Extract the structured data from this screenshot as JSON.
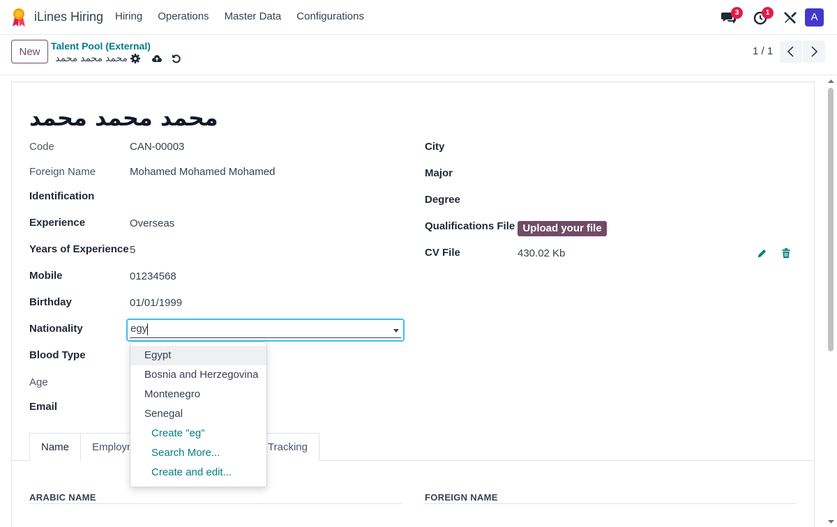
{
  "navbar": {
    "app_name": "iLines Hiring",
    "menu": [
      "Hiring",
      "Operations",
      "Master Data",
      "Configurations"
    ],
    "messages_badge": "3",
    "activities_badge": "1",
    "avatar_letter": "A"
  },
  "control": {
    "new_label": "New",
    "breadcrumb_parent": "Talent Pool (External)",
    "breadcrumb_current": "محمد محمد محمد",
    "pager": "1 / 1"
  },
  "record": {
    "title": "محمد محمد محمد",
    "left_fields": [
      {
        "label": "Code",
        "value": "CAN-00003",
        "bold": false
      },
      {
        "label": "Foreign Name",
        "value": "Mohamed Mohamed Mohamed",
        "bold": false
      },
      {
        "label": "Identification",
        "value": "",
        "bold": true
      },
      {
        "label": "Experience",
        "value": "Overseas",
        "bold": true
      },
      {
        "label": "Years of Experience",
        "value": "5",
        "bold": true
      },
      {
        "label": "Mobile",
        "value": "01234568",
        "bold": true
      },
      {
        "label": "Birthday",
        "value": "01/01/1999",
        "bold": true
      },
      {
        "label": "Nationality",
        "value": "",
        "bold": true
      },
      {
        "label": "Blood Type",
        "value": "",
        "bold": true
      },
      {
        "label": "Age",
        "value": "",
        "bold": false
      },
      {
        "label": "Email",
        "value": "",
        "bold": true
      }
    ],
    "right_fields": [
      {
        "label": "City",
        "value": ""
      },
      {
        "label": "Major",
        "value": ""
      },
      {
        "label": "Degree",
        "value": ""
      },
      {
        "label": "Qualifications File",
        "value": ""
      },
      {
        "label": "CV File",
        "value": "430.02 Kb"
      }
    ],
    "upload_label": "Upload your file",
    "nationality_input": "egy"
  },
  "dropdown": {
    "options": [
      "Egypt",
      "Bosnia and Herzegovina",
      "Montenegro",
      "Senegal"
    ],
    "actions": [
      "Create \"eg\"",
      "Search More...",
      "Create and edit..."
    ]
  },
  "tabs": [
    "Name",
    "Employm",
    "Tracking"
  ],
  "sections": {
    "arabic_name": "ARABIC NAME",
    "foreign_name": "FOREIGN NAME"
  },
  "colors": {
    "brand": "#714b67",
    "link": "#017e84",
    "badge": "#e11d48",
    "focus": "#38bdf8",
    "avatar": "#4338ca"
  }
}
